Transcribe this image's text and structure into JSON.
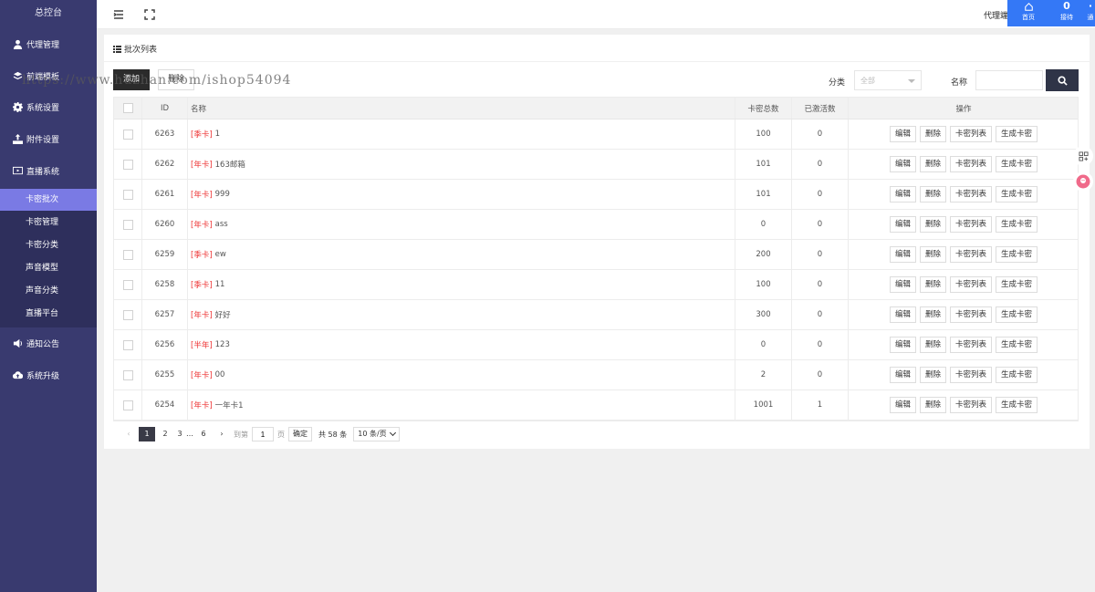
{
  "sidebar": {
    "brand": "总控台",
    "items": [
      {
        "label": "代理管理",
        "icon": "user-icon"
      },
      {
        "label": "前端模板",
        "icon": "layers-icon"
      },
      {
        "label": "系统设置",
        "icon": "gear-icon"
      },
      {
        "label": "附件设置",
        "icon": "upload-icon"
      },
      {
        "label": "直播系统",
        "icon": "tv-icon"
      },
      {
        "label": "通知公告",
        "icon": "speaker-icon"
      },
      {
        "label": "系统升级",
        "icon": "cloud-icon"
      }
    ],
    "submenu": [
      {
        "label": "卡密批次",
        "active": true
      },
      {
        "label": "卡密管理"
      },
      {
        "label": "卡密分类"
      },
      {
        "label": "声音模型"
      },
      {
        "label": "声音分类"
      },
      {
        "label": "直播平台"
      }
    ]
  },
  "header": {
    "agent_label": "代理端",
    "home_label": "首页",
    "counter_value": "0",
    "counter_label": "接待",
    "third_label": "通"
  },
  "card": {
    "title": "批次列表",
    "add_button": "添加",
    "delete_button": "删除",
    "filter": {
      "category_label": "分类",
      "category_placeholder": "全部",
      "name_label": "名称",
      "name_value": ""
    }
  },
  "table": {
    "columns": [
      "ID",
      "名称",
      "卡密总数",
      "已激活数",
      "操作"
    ],
    "actions": [
      "编辑",
      "删除",
      "卡密列表",
      "生成卡密"
    ],
    "rows": [
      {
        "id": "6263",
        "tag": "[季卡]",
        "name": "1",
        "total": "100",
        "activated": "0"
      },
      {
        "id": "6262",
        "tag": "[年卡]",
        "name": "163邮箱",
        "total": "101",
        "activated": "0"
      },
      {
        "id": "6261",
        "tag": "[年卡]",
        "name": "999",
        "total": "101",
        "activated": "0"
      },
      {
        "id": "6260",
        "tag": "[年卡]",
        "name": "ass",
        "total": "0",
        "activated": "0"
      },
      {
        "id": "6259",
        "tag": "[季卡]",
        "name": "ew",
        "total": "200",
        "activated": "0"
      },
      {
        "id": "6258",
        "tag": "[季卡]",
        "name": "11",
        "total": "100",
        "activated": "0"
      },
      {
        "id": "6257",
        "tag": "[年卡]",
        "name": "好好",
        "total": "300",
        "activated": "0"
      },
      {
        "id": "6256",
        "tag": "[半年]",
        "name": "123",
        "total": "0",
        "activated": "0"
      },
      {
        "id": "6255",
        "tag": "[年卡]",
        "name": "00",
        "total": "2",
        "activated": "0"
      },
      {
        "id": "6254",
        "tag": "[年卡]",
        "name": "一年卡1",
        "total": "1001",
        "activated": "1"
      }
    ]
  },
  "pagination": {
    "pages": [
      "1",
      "2",
      "3",
      "…",
      "6"
    ],
    "current": "1",
    "goto_label": "到第",
    "goto_value": "1",
    "page_unit": "页",
    "confirm": "确定",
    "total_text": "共 58 条",
    "per_page": "10 条/页"
  },
  "watermark": "https://www.huzhan.com/ishop54094"
}
